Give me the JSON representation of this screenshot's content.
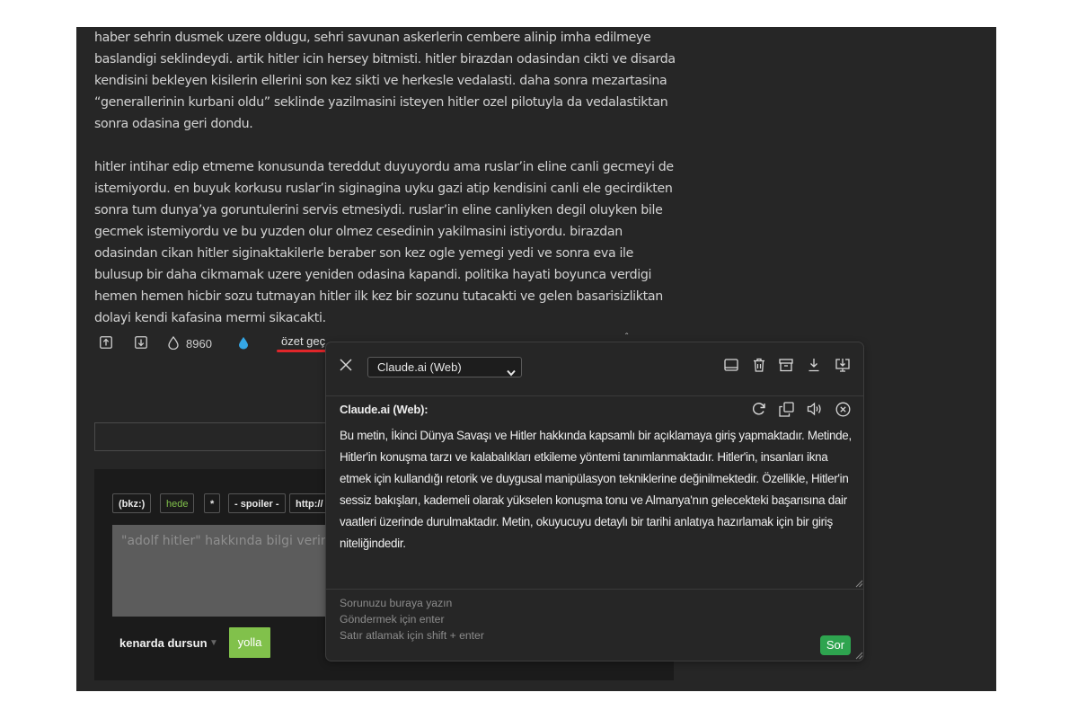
{
  "entry": {
    "paragraphs": [
      "haber sehrin dusmek uzere oldugu, sehri savunan askerlerin cembere alinip imha edilmeye baslandigi seklindeydi. artik hitler icin hersey bitmisti. hitler birazdan odasindan cikti ve disarda kendisini bekleyen kisilerin ellerini son kez sikti ve herkesle vedalasti. daha sonra mezartasina “generallerinin kurbani oldu” seklinde yazilmasini isteyen hitler ozel pilotuyla da vedalastiktan sonra odasina geri dondu.",
      "hitler intihar edip etmeme konusunda tereddut duyuyordu ama ruslar’in eline canli gecmeyi de istemiyordu. en buyuk korkusu ruslar’in siginagina uyku gazi atip kendisini canli ele gecirdikten sonra tum dunya’ya goruntulerini servis etmesiydi. ruslar’in eline canliyken degil oluyken bile gecmek istemiyordu ve bu yuzden olur olmez cesedinin yakilmasini istiyordu. birazdan odasindan cikan hitler siginaktakilerle beraber son kez ogle yemegi yedi ve sonra eva ile bulusup bir daha cikmamak uzere yeniden odasina kapandi. politika hayati boyunca verdigi hemen hemen hicbir sozu tutmayan hitler ilk kez bir sozunu tutacakti ve gelen basarisizliktan dolayi kendi kafasina mermi sikacakti."
    ],
    "favorite_count": "8960",
    "summary_link": "özet geç"
  },
  "editor": {
    "toolbar": [
      "(bkz:)",
      "hede",
      "*",
      "- spoiler -",
      "http://"
    ],
    "placeholder": "\"adolf hitler\" hakkında bilgi verin",
    "draft_label": "kenarda dursun",
    "submit_label": "yolla"
  },
  "panel": {
    "model_select": "Claude.ai (Web)",
    "answer_title": "Claude.ai (Web):",
    "answer_text": "Bu metin, İkinci Dünya Savaşı ve Hitler hakkında kapsamlı bir açıklamaya giriş yapmaktadır. Metinde, Hitler'in konuşma tarzı ve kalabalıkları etkileme yöntemi tanımlanmaktadır. Hitler'in, insanları ikna etmek için kullandığı retorik ve duygusal manipülasyon tekniklerine değinilmektedir. Özellikle, Hitler'in sessiz bakışları, kademeli olarak yükselen konuşma tonu ve Almanya'nın gelecekteki başarısına dair vaatleri üzerinde durulmaktadır. Metin, okuyucuyu detaylı bir tarihi anlatıya hazırlamak için bir giriş niteliğindedir.",
    "input_hint_1": "Sorunuzu buraya yazın",
    "input_hint_2": "Göndermek için enter",
    "input_hint_3": "Satır atlamak için shift + enter",
    "ask_button": "Sor"
  },
  "colors": {
    "page_bg": "#262626",
    "accent_green": "#81c14b",
    "send_green": "#2ea44f",
    "underline_red": "#e0262a",
    "drop_blue": "#35a7e6"
  },
  "icons": [
    "arrow-up-box-icon",
    "arrow-down-box-icon",
    "drop-outline-icon",
    "drop-filled-icon",
    "close-icon",
    "chevron-down-icon",
    "window-icon",
    "trash-icon",
    "archive-icon",
    "download-icon",
    "download-screen-icon",
    "refresh-icon",
    "copy-icon",
    "speaker-icon",
    "circle-x-icon"
  ]
}
